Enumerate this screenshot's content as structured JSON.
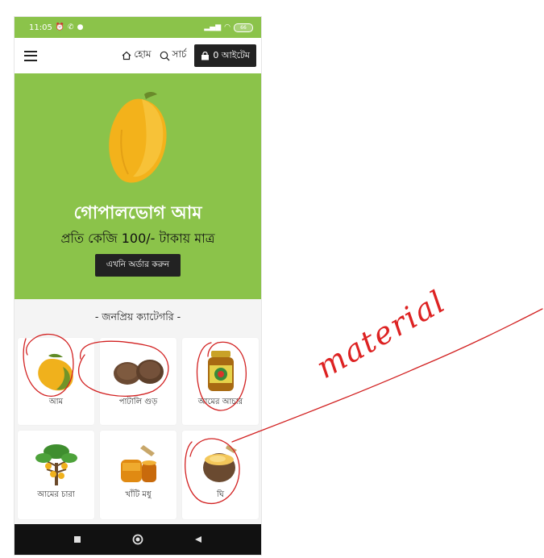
{
  "status_bar": {
    "time": "11:05",
    "battery": "66"
  },
  "navbar": {
    "home_label": "হোম",
    "search_label": "সার্চ",
    "cart_label": "0 আইটেম"
  },
  "hero": {
    "title": "গোপালভোগ আম",
    "subtitle": "প্রতি কেজি 100/- টাকায় মাত্র",
    "button_label": "এখনি অর্ডার করুন"
  },
  "categories": {
    "heading": "- জনপ্রিয় ক্যাটেগরি -",
    "items": [
      {
        "label": "আম",
        "icon": "mango-image"
      },
      {
        "label": "পাটালি গুড়",
        "icon": "jaggery-image"
      },
      {
        "label": "আমের আচার",
        "icon": "pickle-jar-image"
      },
      {
        "label": "আমের চারা",
        "icon": "mango-sapling-image"
      },
      {
        "label": "খাঁটি মধু",
        "icon": "honey-image"
      },
      {
        "label": "ঘি",
        "icon": "ghee-pot-image"
      }
    ]
  },
  "annotation": {
    "text": "material",
    "color": "#d22222"
  },
  "colors": {
    "brand_green": "#8bc34a",
    "dark_button": "#222222"
  }
}
